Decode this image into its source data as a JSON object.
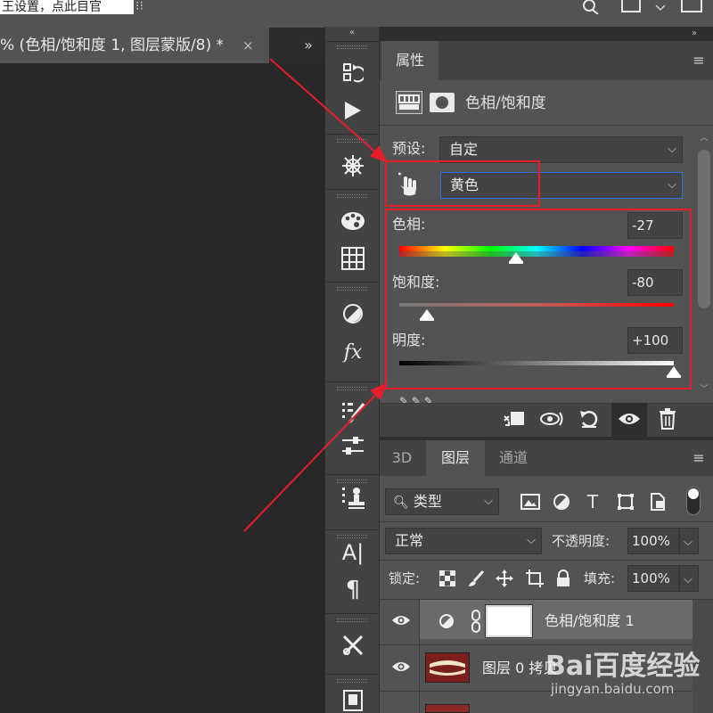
{
  "top_hint": "王设置，点此目官",
  "document_tab": {
    "title": "% (色相/饱和度 1, 图层蒙版/8) *",
    "close": "×",
    "collapse": "»"
  },
  "toolcol": {
    "collapse": "«"
  },
  "properties": {
    "panel_collapse": "»",
    "tab": "属性",
    "menu": "≡",
    "adjustment_title": "色相/饱和度",
    "preset_label": "预设:",
    "preset_value": "自定",
    "channel_value": "黄色",
    "hue_label": "色相:",
    "hue_value": "-27",
    "hue_slider": -27,
    "saturation_label": "饱和度:",
    "saturation_value": "-80",
    "saturation_slider": -80,
    "lightness_label": "明度:",
    "lightness_value": "+100",
    "lightness_slider": 100,
    "slider_range": [
      -180,
      180
    ],
    "slider_range_sl": [
      -100,
      100
    ]
  },
  "layers": {
    "tabs": [
      "3D",
      "图层",
      "通道"
    ],
    "menu": "≡",
    "filter_label": "类型",
    "blend_mode": "正常",
    "opacity_label": "不透明度:",
    "opacity_value": "100%",
    "lock_label": "锁定:",
    "fill_label": "填充:",
    "fill_value": "100%",
    "layer_rows": [
      {
        "name": "色相/饱和度 1"
      },
      {
        "name": "图层 0 拷贝"
      }
    ]
  },
  "watermark": {
    "logo": "Bai百度经验",
    "url": "jingyan.baidu.com"
  },
  "colors": {
    "annotation_red": "#e41e2b",
    "panel_bg": "#535353",
    "canvas_bg": "#282828",
    "accent_blue": "#2f6fd1"
  }
}
